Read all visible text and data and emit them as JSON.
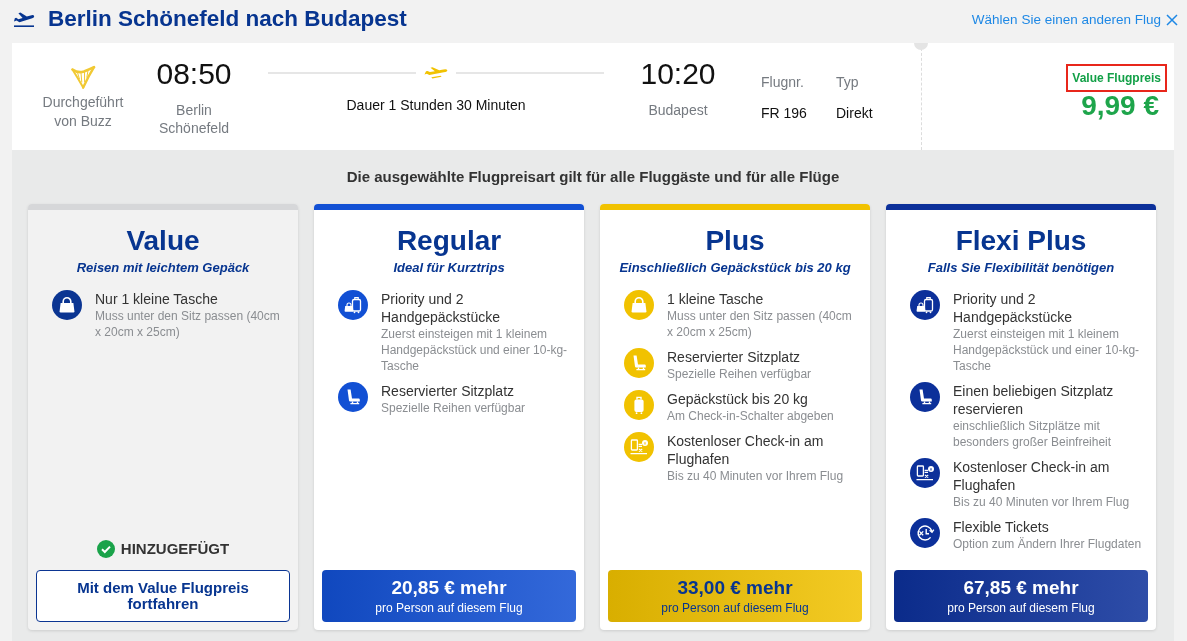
{
  "header": {
    "title": "Berlin Schönefeld nach Budapest",
    "change_link": "Wählen Sie einen anderen Flug"
  },
  "flight": {
    "operator": "Durchgeführt von Buzz",
    "departure": {
      "time": "08:50",
      "airport": "Berlin Schönefeld"
    },
    "duration": "Dauer 1 Stunden 30 Minuten",
    "arrival": {
      "time": "10:20",
      "airport": "Budapest"
    },
    "details": [
      {
        "label": "Flugnr.",
        "value": "FR 196"
      },
      {
        "label": "Typ",
        "value": "Direkt"
      }
    ],
    "fare": {
      "label": "Value Flugpreis",
      "highlighted": true,
      "price": "9,99 €"
    }
  },
  "notice": "Die ausgewählte Flugpreisart gilt für alle Fluggäste und für alle Flüge",
  "fares": [
    {
      "name": "Value",
      "tagline": "Reisen mit leichtem Gepäck",
      "color": "#0b3592",
      "selected": true,
      "features": [
        {
          "kind": "handbag",
          "title": "Nur 1 kleine Tasche",
          "detail": "Muss unter den Sitz passen (40cm x 20cm x 25cm)"
        }
      ],
      "status": "HINZUGEFÜGT",
      "action": "Mit dem Value Flugpreis fortfahren"
    },
    {
      "name": "Regular",
      "tagline": "Ideal für Kurztrips",
      "color": "#1250d4",
      "selected": false,
      "features": [
        {
          "kind": "priority",
          "title": "Priority und 2 Handgepäckstücke",
          "detail": "Zuerst einsteigen mit 1 kleinem Handgepäckstück und einer 10-kg-Tasche"
        },
        {
          "kind": "seat",
          "title": "Reservierter Sitzplatz",
          "detail": "Spezielle Reihen verfügbar"
        }
      ],
      "price": "20,85 € mehr",
      "price_note": "pro Person auf diesem Flug"
    },
    {
      "name": "Plus",
      "tagline": "Einschließlich Gepäckstück bis 20 kg",
      "color": "#f1c200",
      "selected": false,
      "features": [
        {
          "kind": "handbag",
          "title": "1 kleine Tasche",
          "detail": "Muss unter den Sitz passen (40cm x 20cm x 25cm)"
        },
        {
          "kind": "seat",
          "title": "Reservierter Sitzplatz",
          "detail": "Spezielle Reihen verfügbar"
        },
        {
          "kind": "suitcase",
          "title": "Gepäckstück bis 20 kg",
          "detail": "Am Check-in-Schalter abgeben"
        },
        {
          "kind": "checkin",
          "title": "Kostenloser Check-in am Flughafen",
          "detail": "Bis zu 40 Minuten vor Ihrem Flug"
        }
      ],
      "price": "33,00 € mehr",
      "price_note": "pro Person auf diesem Flug"
    },
    {
      "name": "Flexi Plus",
      "tagline": "Falls Sie Flexibilität benötigen",
      "color": "#0c309a",
      "selected": false,
      "features": [
        {
          "kind": "priority",
          "title": "Priority und 2 Handgepäckstücke",
          "detail": "Zuerst einsteigen mit 1 kleinem Handgepäckstück und einer 10-kg-Tasche"
        },
        {
          "kind": "seat",
          "title": "Einen beliebigen Sitzplatz reservieren",
          "detail": "einschließlich Sitzplätze mit besonders großer Beinfreiheit"
        },
        {
          "kind": "checkin",
          "title": "Kostenloser Check-in am Flughafen",
          "detail": "Bis zu 40 Minuten vor Ihrem Flug"
        },
        {
          "kind": "flexible",
          "title": "Flexible Tickets",
          "detail": "Option zum Ändern Ihrer Flugdaten"
        }
      ],
      "price": "67,85 € mehr",
      "price_note": "pro Person auf diesem Flug"
    }
  ]
}
